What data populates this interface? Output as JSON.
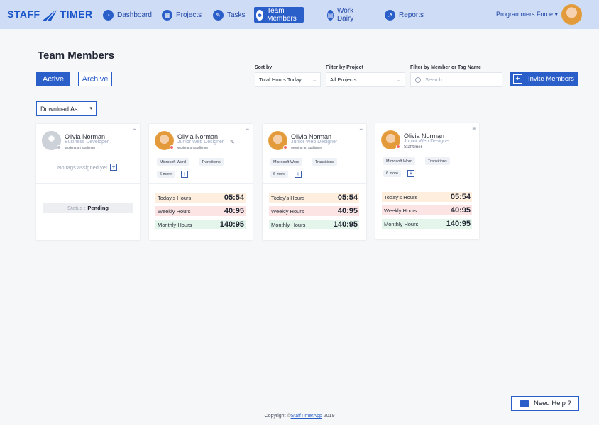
{
  "header": {
    "logo_left": "STAFF",
    "logo_right": "TIMER",
    "nav": [
      {
        "label": "Dashboard",
        "icon": "dashboard-icon"
      },
      {
        "label": "Projects",
        "icon": "projects-icon"
      },
      {
        "label": "Tasks",
        "icon": "tasks-icon"
      },
      {
        "label": "Team Members",
        "icon": "team-icon",
        "active": true
      },
      {
        "label": "Work Dairy",
        "icon": "diary-icon"
      },
      {
        "label": "Reports",
        "icon": "reports-icon"
      }
    ],
    "org_name": "Programmers Force"
  },
  "page": {
    "title": "Team Members",
    "active_label": "Active",
    "archive_label": "Archive",
    "download_label": "Download As"
  },
  "filters": {
    "sort_label": "Sort by",
    "sort_value": "Total Hours Today",
    "project_label": "Filter by Project",
    "project_value": "All Projects",
    "member_label": "Filter by Member or Tag Name",
    "search_placeholder": "Search",
    "invite_label": "Invite Members"
  },
  "cards": [
    {
      "name": "Olivia Norman",
      "role": "Business Developer",
      "sub": "Working on Stafftimer",
      "no_tags": "No tags assigned yet",
      "status_label": "Status :",
      "status_value": "Pending"
    },
    {
      "name": "Olivia Norman",
      "role": "Junior Web Designer",
      "sub": "Working on Stafftimer",
      "tags": [
        "Microsoft Word",
        "Transitions"
      ],
      "more": "6 more",
      "today_label": "Today's Hours",
      "today": "05:54",
      "weekly_label": "Weekly Hours",
      "weekly": "40:95",
      "monthly_label": "Monthly Hours",
      "monthly": "140:95"
    },
    {
      "name": "Olivia Norman",
      "role": "Junior Web Designer",
      "sub": "Working on Stafftimer",
      "tags": [
        "Microsoft Word",
        "Transitions"
      ],
      "more": "6 more",
      "today_label": "Today's Hours",
      "today": "05:54",
      "weekly_label": "Weekly Hours",
      "weekly": "40:95",
      "monthly_label": "Monthly Hours",
      "monthly": "140:95"
    },
    {
      "name": "Olivia Norman",
      "role": "Junior Web Designer",
      "sub": "Stafftimer",
      "tags": [
        "Microsoft Word",
        "Transitions"
      ],
      "more": "6 more",
      "today_label": "Today's Hours",
      "today": "05:54",
      "weekly_label": "Weekly Hours",
      "weekly": "40:95",
      "monthly_label": "Monthly Hours",
      "monthly": "140:95"
    }
  ],
  "help_label": "Need Help ?",
  "footer": {
    "prefix": "Copyright ©",
    "link": "StaffTimerApp",
    "year": "2019"
  }
}
